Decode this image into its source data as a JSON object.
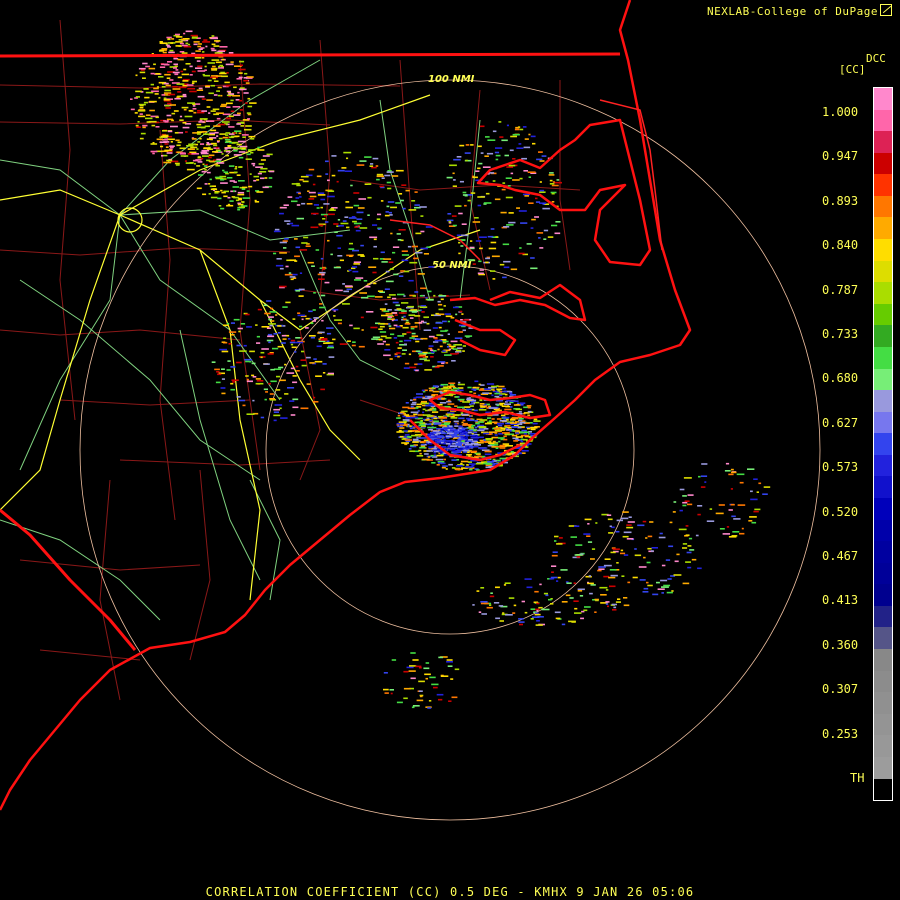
{
  "header": {
    "credit": "NEXLAB-College of DuPage"
  },
  "footer": {
    "title": "CORRELATION COEFFICIENT (CC) 0.5 DEG - KMHX 9 JAN 26 05:06"
  },
  "range_rings": {
    "inner_label": "50 NMI",
    "outer_label": "100 NMI"
  },
  "legend": {
    "product_code": "DCC",
    "unit": "[CC]",
    "ticks": [
      "1.000",
      "0.947",
      "0.893",
      "0.840",
      "0.787",
      "0.733",
      "0.680",
      "0.627",
      "0.573",
      "0.520",
      "0.467",
      "0.413",
      "0.360",
      "0.307",
      "0.253",
      "TH"
    ],
    "colors": [
      "#ff88cc",
      "#ff66aa",
      "#dd2255",
      "#cc0000",
      "#ff3300",
      "#ff7700",
      "#ffaa00",
      "#ffdd00",
      "#dddd00",
      "#aadd00",
      "#66cc00",
      "#33aa22",
      "#44dd44",
      "#77ee77",
      "#9999dd",
      "#7777ee",
      "#3344ee",
      "#2222dd",
      "#1111cc",
      "#0000bb",
      "#0000aa",
      "#0000a0",
      "#000099",
      "#00008f",
      "#222288",
      "#555588",
      "#888888",
      "#8c8c8c",
      "#909090",
      "#949494",
      "#989898",
      "#9c9c9c",
      "#000000"
    ]
  },
  "accent_colors": {
    "state_border": "#ff1111",
    "county_lines": "#9a1a1a",
    "highways": "#ffff33",
    "roads": "#88dd88",
    "range_rings": "#f0c0a0",
    "text": "#ffff55"
  }
}
